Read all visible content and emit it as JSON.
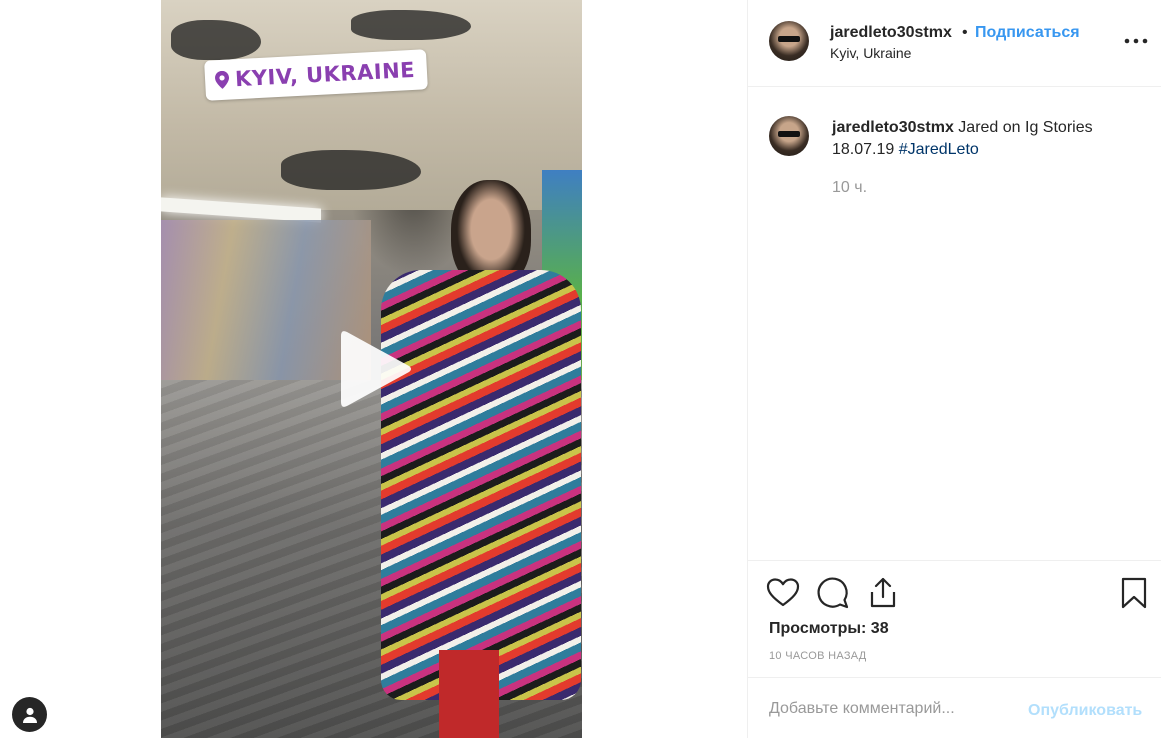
{
  "media": {
    "location_sticker": "KYIV, UKRAINE",
    "play_icon": "play-icon",
    "pin_icon": "pin-icon",
    "user_icon": "user-icon"
  },
  "header": {
    "username": "jaredleto30stmx",
    "separator": "•",
    "follow_label": "Подписаться",
    "location": "Kyiv, Ukraine",
    "more_icon": "more-options-icon"
  },
  "caption": {
    "username": "jaredleto30stmx",
    "text": "Jared on Ig Stories 18.07.19",
    "hashtag": "#JaredLeto",
    "time": "10 ч."
  },
  "actions": {
    "icons": [
      "heart-icon",
      "comment-icon",
      "share-icon",
      "bookmark-icon"
    ],
    "views_label": "Просмотры:",
    "views_count": "38",
    "posted_ago": "10 часов назад"
  },
  "comment": {
    "placeholder": "Добавьте комментарий...",
    "publish_label": "Опубликовать"
  },
  "colors": {
    "accent": "#3897f0",
    "publish_disabled": "#b2dffc",
    "sticker_text": "#8a3fb0",
    "muted": "#999999"
  }
}
